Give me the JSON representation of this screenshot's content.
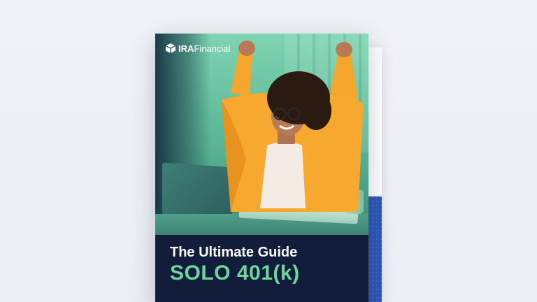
{
  "brochure": {
    "brand_bold": "IRA",
    "brand_regular": "Financial",
    "subtitle": "The Ultimate Guide",
    "title": "SOLO 401(k)",
    "logo_icon": "cube-icon",
    "colors": {
      "background": "#eff0f6",
      "cover_navy": "#121d3c",
      "title_green": "#6fd59a",
      "photo_green": "#7fd4b3",
      "shirt_orange": "#f6a92e",
      "back_panel_blue": "#2f56b8"
    }
  }
}
